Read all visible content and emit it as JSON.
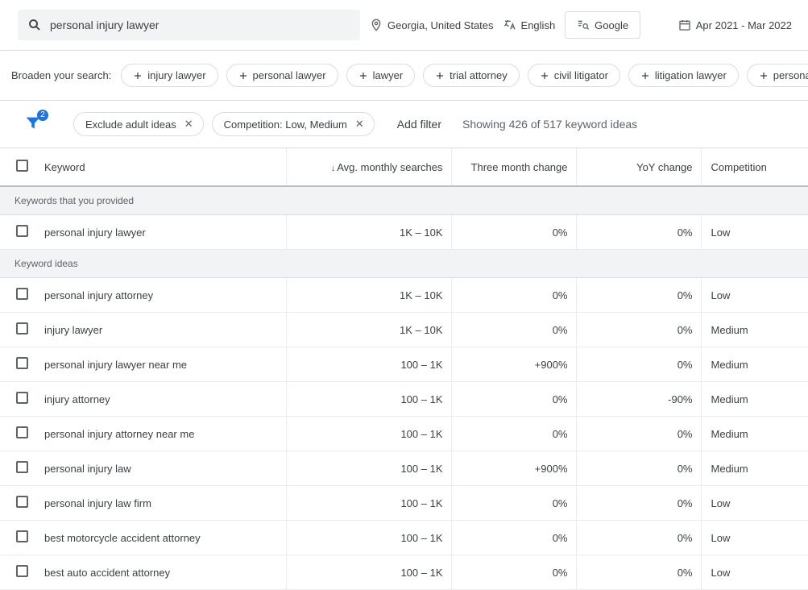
{
  "search": {
    "value": "personal injury lawyer"
  },
  "location": "Georgia, United States",
  "language": "English",
  "network": "Google",
  "date_range": "Apr 2021 - Mar 2022",
  "broaden": {
    "label": "Broaden your search:",
    "chips": [
      "injury lawyer",
      "personal lawyer",
      "lawyer",
      "trial attorney",
      "civil litigator",
      "litigation lawyer",
      "personal injury"
    ]
  },
  "filters": {
    "count": "2",
    "chips": [
      "Exclude adult ideas",
      "Competition: Low, Medium"
    ],
    "add_label": "Add filter",
    "showing": "Showing 426 of 517 keyword ideas"
  },
  "columns": {
    "keyword": "Keyword",
    "avg": "Avg. monthly searches",
    "three": "Three month change",
    "yoy": "YoY change",
    "comp": "Competition"
  },
  "sections": {
    "provided": "Keywords that you provided",
    "ideas": "Keyword ideas"
  },
  "rows_provided": [
    {
      "keyword": "personal injury lawyer",
      "avg": "1K – 10K",
      "three": "0%",
      "yoy": "0%",
      "comp": "Low"
    }
  ],
  "rows_ideas": [
    {
      "keyword": "personal injury attorney",
      "avg": "1K – 10K",
      "three": "0%",
      "yoy": "0%",
      "comp": "Low"
    },
    {
      "keyword": "injury lawyer",
      "avg": "1K – 10K",
      "three": "0%",
      "yoy": "0%",
      "comp": "Medium"
    },
    {
      "keyword": "personal injury lawyer near me",
      "avg": "100 – 1K",
      "three": "+900%",
      "yoy": "0%",
      "comp": "Medium"
    },
    {
      "keyword": "injury attorney",
      "avg": "100 – 1K",
      "three": "0%",
      "yoy": "-90%",
      "comp": "Medium"
    },
    {
      "keyword": "personal injury attorney near me",
      "avg": "100 – 1K",
      "three": "0%",
      "yoy": "0%",
      "comp": "Medium"
    },
    {
      "keyword": "personal injury law",
      "avg": "100 – 1K",
      "three": "+900%",
      "yoy": "0%",
      "comp": "Medium"
    },
    {
      "keyword": "personal injury law firm",
      "avg": "100 – 1K",
      "three": "0%",
      "yoy": "0%",
      "comp": "Low"
    },
    {
      "keyword": "best motorcycle accident attorney",
      "avg": "100 – 1K",
      "three": "0%",
      "yoy": "0%",
      "comp": "Low"
    },
    {
      "keyword": "best auto accident attorney",
      "avg": "100 – 1K",
      "three": "0%",
      "yoy": "0%",
      "comp": "Low"
    }
  ]
}
